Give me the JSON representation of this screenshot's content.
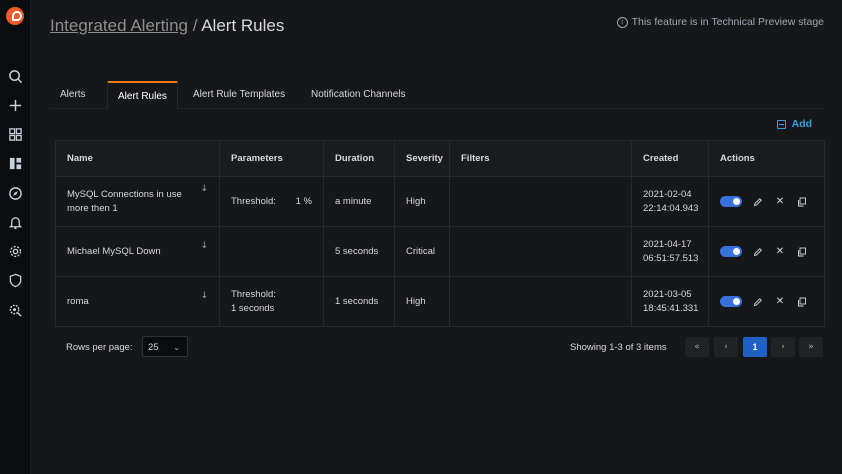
{
  "header": {
    "breadcrumb_parent": "Integrated Alerting",
    "separator": " / ",
    "title": "Alert Rules",
    "preview_note": "This feature is in Technical Preview stage"
  },
  "sidebar": {
    "icons": [
      "percona-logo",
      "search-icon",
      "plus-icon",
      "dashboards-icon",
      "panel-icon",
      "explore-icon",
      "bell-icon",
      "gear-icon",
      "shield-icon",
      "server-search-icon"
    ]
  },
  "tabs": [
    {
      "label": "Alerts",
      "active": false
    },
    {
      "label": "Alert Rules",
      "active": true
    },
    {
      "label": "Alert Rule Templates",
      "active": false
    },
    {
      "label": "Notification Channels",
      "active": false
    }
  ],
  "add_button": "Add",
  "table": {
    "columns": [
      "Name",
      "Parameters",
      "Duration",
      "Severity",
      "Filters",
      "Created",
      "Actions"
    ],
    "rows": [
      {
        "name": "MySQL Connections in use more then 1",
        "param_label": "Threshold:",
        "param_value": "1 %",
        "duration": "a minute",
        "severity": "High",
        "filters": "",
        "created_date": "2021-02-04",
        "created_time": "22:14:04.943"
      },
      {
        "name": "Michael MySQL Down",
        "param_label": "",
        "param_value": "",
        "duration": "5 seconds",
        "severity": "Critical",
        "filters": "",
        "created_date": "2021-04-17",
        "created_time": "06:51:57.513"
      },
      {
        "name": "roma",
        "param_label": "Threshold:",
        "param_value": "1 seconds",
        "duration": "1 seconds",
        "severity": "High",
        "filters": "",
        "created_date": "2021-03-05",
        "created_time": "18:45:41.331"
      }
    ]
  },
  "pagination": {
    "rows_per_page_label": "Rows per page:",
    "rows_per_page_value": "25",
    "showing": "Showing 1-3 of 3 items",
    "first": "«",
    "prev": "‹",
    "current": "1",
    "next": "›",
    "last": "»"
  },
  "colors": {
    "accent": "#eb7b18",
    "link": "#33a2e5",
    "high": "#eb7b18",
    "critical": "#e02f44",
    "toggle": "#3871dc"
  }
}
